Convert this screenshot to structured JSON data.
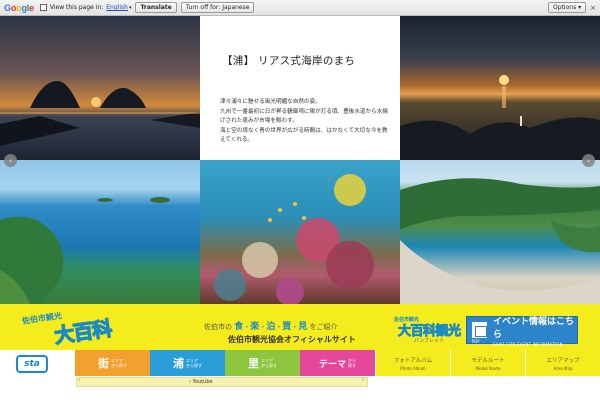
{
  "translate_bar": {
    "logo_letters": [
      "G",
      "o",
      "o",
      "g",
      "l",
      "e"
    ],
    "view_text": "View this page in:",
    "language": "English",
    "translate_button": "Translate",
    "turn_off_button": "Turn off for: Japanese",
    "options_button": "Options ▾",
    "close_icon": "×"
  },
  "intro": {
    "title": "【浦】 リアス式海岸のまち",
    "body_lines": [
      "津々浦々に魅せる風光明媚な自然の姿。",
      "九州で一番最初に日が昇る鶴御埼に陽が灯る頃、豊後水道から水揚げされた恵みが市場を賑わす。",
      "海と空の境なく青の世界が広がる時間は、はかなくて大切な今を教えてくれる。"
    ]
  },
  "slider": {
    "prev_icon": "‹",
    "next_icon": "›"
  },
  "banner": {
    "logo_small": "佐伯市観光",
    "logo_big": "大百科",
    "tagline_prefix": "佐伯市の",
    "tagline_items": [
      "食",
      "楽",
      "泊",
      "買",
      "見"
    ],
    "tagline_suffix": "をご紹介",
    "subtitle": "佐伯市観光協会オフィシャルサイト",
    "small_logo_top": "佐伯市観光",
    "small_logo_big": "大百科観光",
    "small_logo_bottom": "パンフレット",
    "event_main": "イベント情報はこちら",
    "event_sub": "SAIKI CITY EVENT INFORMATION",
    "event_pdf": "PDF"
  },
  "nav": {
    "site_logo": "sta",
    "categories": [
      {
        "big": "街",
        "small1": "エリア",
        "small2": "から探す",
        "color": "#f2a12e"
      },
      {
        "big": "浦",
        "small1": "エリア",
        "small2": "から探す",
        "color": "#2a9ed8"
      },
      {
        "big": "里",
        "small1": "エリア",
        "small2": "から探す",
        "color": "#8cc63f"
      },
      {
        "big": "テーマ",
        "small1": "から",
        "small2": "探す",
        "color": "#e5479a"
      }
    ],
    "links": [
      {
        "jp": "フォトアルバム",
        "en": "Photo Album"
      },
      {
        "jp": "モデルルート",
        "en": "Model Route"
      },
      {
        "jp": "エリアマップ",
        "en": "Area Map"
      }
    ]
  },
  "bottom": {
    "youtube_label": "› Youtube",
    "left_arrow": "‹",
    "right_arrow": "›"
  }
}
